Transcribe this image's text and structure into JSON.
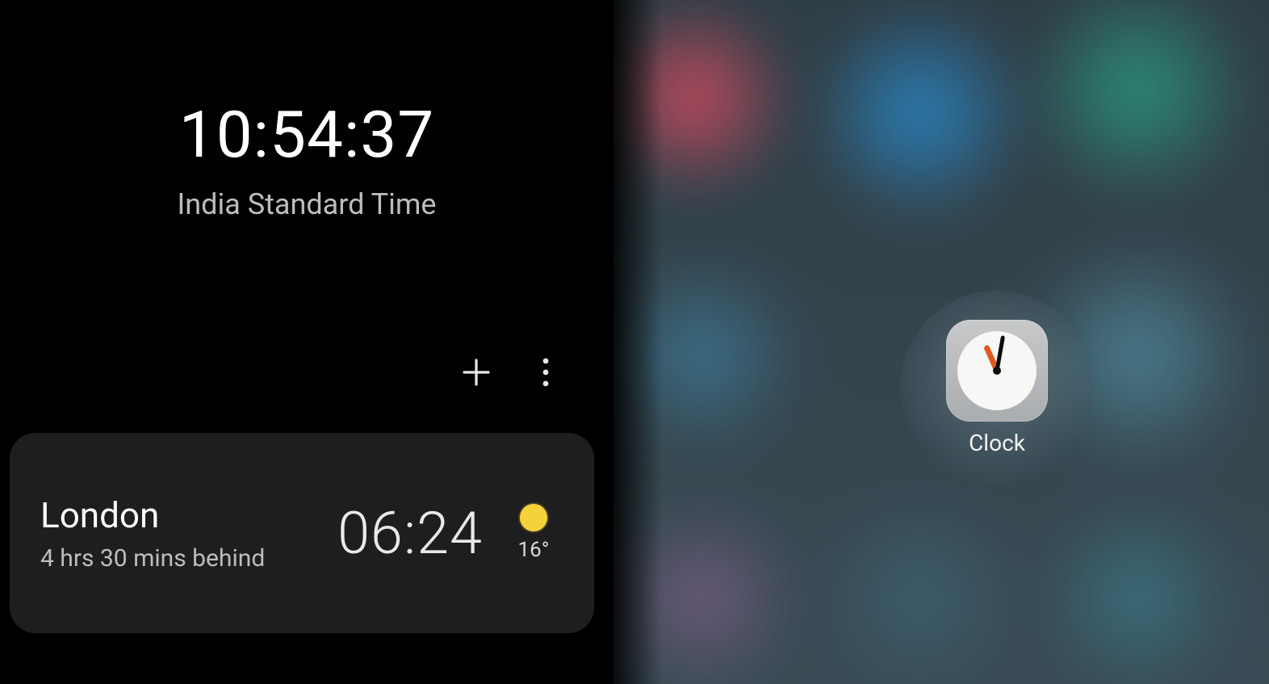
{
  "clock": {
    "time": "10:54:37",
    "timezone_label": "India Standard Time"
  },
  "actions": {
    "add_icon": "plus-icon",
    "more_icon": "more-vertical-icon"
  },
  "world_clocks": [
    {
      "city": "London",
      "offset_text": "4 hrs 30 mins behind",
      "time": "06:24",
      "weather_icon": "sun-icon",
      "temperature": "16°"
    }
  ],
  "homescreen": {
    "focused_app": {
      "label": "Clock",
      "icon": "clock-app-icon"
    }
  }
}
